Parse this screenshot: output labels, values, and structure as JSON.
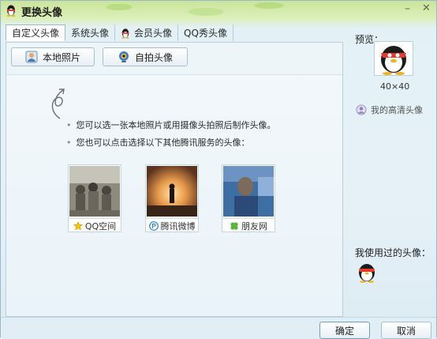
{
  "window": {
    "title": "更换头像"
  },
  "tabs": [
    {
      "label": "自定义头像",
      "active": true
    },
    {
      "label": "系统头像"
    },
    {
      "label": "会员头像",
      "icon": "qq-penguin-icon"
    },
    {
      "label": "QQ秀头像"
    }
  ],
  "actions": {
    "local_photo": "本地照片",
    "selfie": "自拍头像"
  },
  "hints": [
    "您可以选一张本地照片或用摄像头拍照后制作头像。",
    "您也可以点击选择以下其他腾讯服务的头像："
  ],
  "services": [
    {
      "label": "QQ空间",
      "icon": "star-icon"
    },
    {
      "label": "腾讯微博",
      "icon": "weibo-icon"
    },
    {
      "label": "朋友网",
      "icon": "clover-icon"
    }
  ],
  "preview": {
    "label": "预览：",
    "size": "40×40",
    "hd_link": "我的高清头像"
  },
  "history": {
    "label": "我使用过的头像："
  },
  "footer": {
    "ok": "确定",
    "cancel": "取消"
  },
  "colors": {
    "title_bar": "#c9e59a",
    "panel_bg": "#eaf3f9",
    "accent_border": "#6d9fc0"
  }
}
